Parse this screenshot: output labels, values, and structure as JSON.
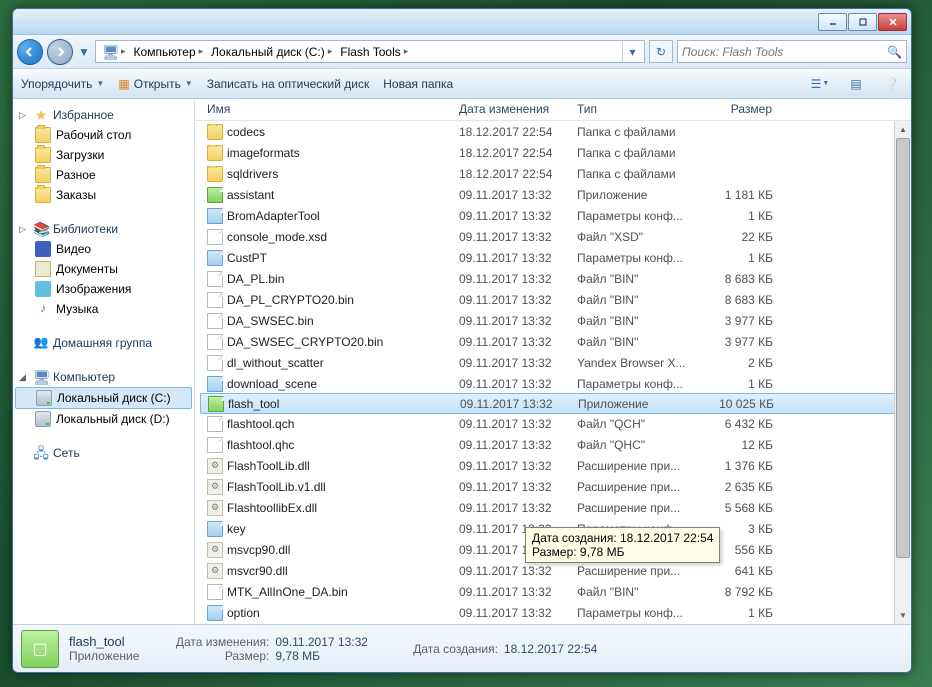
{
  "titlebar": {},
  "breadcrumb": {
    "segments": [
      "Компьютер",
      "Локальный диск (C:)",
      "Flash Tools"
    ]
  },
  "search": {
    "placeholder": "Поиск: Flash Tools"
  },
  "toolbar": {
    "organize": "Упорядочить",
    "open": "Открыть",
    "burn": "Записать на оптический диск",
    "newfolder": "Новая папка"
  },
  "sidebar": {
    "favorites": {
      "label": "Избранное",
      "items": [
        "Рабочий стол",
        "Загрузки",
        "Разное",
        "Заказы"
      ]
    },
    "libraries": {
      "label": "Библиотеки",
      "items": [
        "Видео",
        "Документы",
        "Изображения",
        "Музыка"
      ]
    },
    "homegroup": {
      "label": "Домашняя группа"
    },
    "computer": {
      "label": "Компьютер",
      "items": [
        "Локальный диск (C:)",
        "Локальный диск (D:)"
      ]
    },
    "network": {
      "label": "Сеть"
    }
  },
  "columns": {
    "name": "Имя",
    "date": "Дата изменения",
    "type": "Тип",
    "size": "Размер"
  },
  "files": [
    {
      "icon": "folder",
      "name": "codecs",
      "date": "18.12.2017 22:54",
      "type": "Папка с файлами",
      "size": ""
    },
    {
      "icon": "folder",
      "name": "imageformats",
      "date": "18.12.2017 22:54",
      "type": "Папка с файлами",
      "size": ""
    },
    {
      "icon": "folder",
      "name": "sqldrivers",
      "date": "18.12.2017 22:54",
      "type": "Папка с файлами",
      "size": ""
    },
    {
      "icon": "exe-green",
      "name": "assistant",
      "date": "09.11.2017 13:32",
      "type": "Приложение",
      "size": "1 181 КБ"
    },
    {
      "icon": "exe",
      "name": "BromAdapterTool",
      "date": "09.11.2017 13:32",
      "type": "Параметры конф...",
      "size": "1 КБ"
    },
    {
      "icon": "file",
      "name": "console_mode.xsd",
      "date": "09.11.2017 13:32",
      "type": "Файл \"XSD\"",
      "size": "22 КБ"
    },
    {
      "icon": "exe",
      "name": "CustPT",
      "date": "09.11.2017 13:32",
      "type": "Параметры конф...",
      "size": "1 КБ"
    },
    {
      "icon": "file",
      "name": "DA_PL.bin",
      "date": "09.11.2017 13:32",
      "type": "Файл \"BIN\"",
      "size": "8 683 КБ"
    },
    {
      "icon": "file",
      "name": "DA_PL_CRYPTO20.bin",
      "date": "09.11.2017 13:32",
      "type": "Файл \"BIN\"",
      "size": "8 683 КБ"
    },
    {
      "icon": "file",
      "name": "DA_SWSEC.bin",
      "date": "09.11.2017 13:32",
      "type": "Файл \"BIN\"",
      "size": "3 977 КБ"
    },
    {
      "icon": "file",
      "name": "DA_SWSEC_CRYPTO20.bin",
      "date": "09.11.2017 13:32",
      "type": "Файл \"BIN\"",
      "size": "3 977 КБ"
    },
    {
      "icon": "file",
      "name": "dl_without_scatter",
      "date": "09.11.2017 13:32",
      "type": "Yandex Browser X...",
      "size": "2 КБ"
    },
    {
      "icon": "exe",
      "name": "download_scene",
      "date": "09.11.2017 13:32",
      "type": "Параметры конф...",
      "size": "1 КБ"
    },
    {
      "icon": "exe-green",
      "name": "flash_tool",
      "date": "09.11.2017 13:32",
      "type": "Приложение",
      "size": "10 025 КБ",
      "selected": true
    },
    {
      "icon": "file",
      "name": "flashtool.qch",
      "date": "09.11.2017 13:32",
      "type": "Файл \"QCH\"",
      "size": "6 432 КБ"
    },
    {
      "icon": "file",
      "name": "flashtool.qhc",
      "date": "09.11.2017 13:32",
      "type": "Файл \"QHC\"",
      "size": "12 КБ"
    },
    {
      "icon": "dll",
      "name": "FlashToolLib.dll",
      "date": "09.11.2017 13:32",
      "type": "Расширение при...",
      "size": "1 376 КБ"
    },
    {
      "icon": "dll",
      "name": "FlashToolLib.v1.dll",
      "date": "09.11.2017 13:32",
      "type": "Расширение при...",
      "size": "2 635 КБ"
    },
    {
      "icon": "dll",
      "name": "FlashtoollibEx.dll",
      "date": "09.11.2017 13:32",
      "type": "Расширение при...",
      "size": "5 568 КБ"
    },
    {
      "icon": "exe",
      "name": "key",
      "date": "09.11.2017 13:32",
      "type": "Параметры конф...",
      "size": "3 КБ"
    },
    {
      "icon": "dll",
      "name": "msvcp90.dll",
      "date": "09.11.2017 13:32",
      "type": "Расширение при...",
      "size": "556 КБ"
    },
    {
      "icon": "dll",
      "name": "msvcr90.dll",
      "date": "09.11.2017 13:32",
      "type": "Расширение при...",
      "size": "641 КБ"
    },
    {
      "icon": "file",
      "name": "MTK_AllInOne_DA.bin",
      "date": "09.11.2017 13:32",
      "type": "Файл \"BIN\"",
      "size": "8 792 КБ"
    },
    {
      "icon": "exe",
      "name": "option",
      "date": "09.11.2017 13:32",
      "type": "Параметры конф...",
      "size": "1 КБ"
    }
  ],
  "tooltip": {
    "line1_label": "Дата создания:",
    "line1_value": "18.12.2017 22:54",
    "line2_label": "Размер:",
    "line2_value": "9,78 МБ"
  },
  "details": {
    "name": "flash_tool",
    "type": "Приложение",
    "mod_label": "Дата изменения:",
    "mod_value": "09.11.2017 13:32",
    "size_label": "Размер:",
    "size_value": "9,78 МБ",
    "created_label": "Дата создания:",
    "created_value": "18.12.2017 22:54"
  }
}
